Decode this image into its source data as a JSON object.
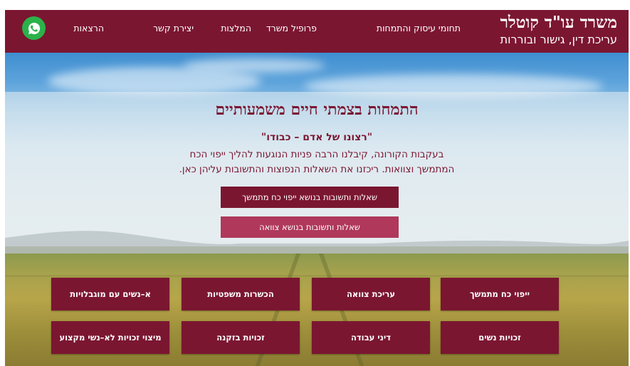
{
  "brand": {
    "title": "משרד עו\"ד קוטלר",
    "subtitle": "עריכת דין, גישור ובוררות"
  },
  "nav": {
    "items": [
      {
        "label": "תחומי עיסוק והתמחות"
      },
      {
        "label": "פרופיל משרד"
      },
      {
        "label": "המלצות"
      },
      {
        "label": "יצירת קשר"
      },
      {
        "label": "הרצאות"
      }
    ]
  },
  "hero": {
    "title": "התמחות בצמתי חיים משמעותיים",
    "quote": "\"רצונו של אדם – כבודו\"",
    "paragraph_line1": "בעקבות הקורונה, קיבלנו הרבה פניות הנוגעות להליך ייפוי הכח",
    "paragraph_line2": "המתמשך וצוואות. ריכזנו את השאלות הנפוצות והתשובות עליהן כאן.",
    "cta_primary": "שאלות ותשובות בנושא ייפוי כח מתמשך",
    "cta_secondary": "שאלות ותשובות בנושא צוואה"
  },
  "tiles": {
    "row1": [
      "ייפוי כח מתמשך",
      "עריכת צוואה",
      "הכשרות משפטיות",
      "א–נשים עם מוגבלויות"
    ],
    "row2": [
      "זכויות נשים",
      "דיני עבודה",
      "זכויות בזקנה",
      "מיצוי זכויות לא–נשי מקצוע"
    ]
  },
  "colors": {
    "brand": "#7b1631",
    "cta_secondary": "#b0385a",
    "whatsapp": "#2bb24a"
  },
  "icons": {
    "whatsapp": "whatsapp-icon"
  }
}
